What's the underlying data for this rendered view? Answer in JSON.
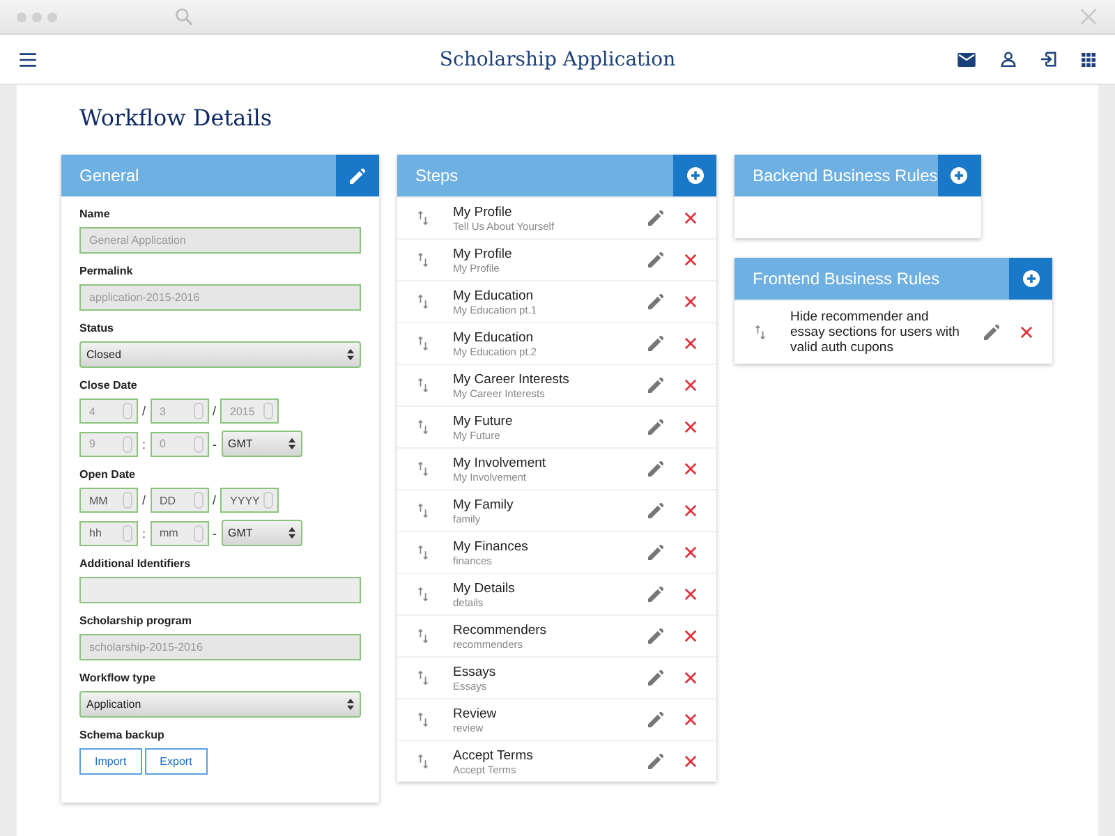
{
  "app_bar": {
    "title": "Scholarship Application"
  },
  "heading": "Workflow Details",
  "general": {
    "title": "General",
    "fields": [
      {
        "kind": "text",
        "label": "Name",
        "value": "General Application",
        "disabled": true
      },
      {
        "kind": "text",
        "label": "Permalink",
        "value": "application-2015-2016",
        "disabled": true
      },
      {
        "kind": "select",
        "label": "Status",
        "value": "Closed"
      },
      {
        "kind": "datetime",
        "label": "Close Date",
        "date": [
          {
            "value": "4"
          },
          {
            "separator": "/",
            "value": "3"
          },
          {
            "separator": "/",
            "value": "2015"
          }
        ],
        "time": [
          {
            "value": "9"
          },
          {
            "separator": ":",
            "value": "0"
          }
        ],
        "zone_separator": "-",
        "timezone": "GMT"
      },
      {
        "kind": "datetime",
        "label": "Open Date",
        "date": [
          {
            "placeholder": "MM"
          },
          {
            "separator": "/",
            "placeholder": "DD"
          },
          {
            "separator": "/",
            "placeholder": "YYYY"
          }
        ],
        "time": [
          {
            "placeholder": "hh"
          },
          {
            "separator": ":",
            "placeholder": "mm"
          }
        ],
        "zone_separator": "-",
        "timezone": "GMT"
      },
      {
        "kind": "text",
        "label": "Additional Identifiers"
      },
      {
        "kind": "text",
        "label": "Scholarship program",
        "value": "scholarship-2015-2016",
        "disabled": true
      },
      {
        "kind": "select",
        "label": "Workflow type",
        "value": "Application"
      },
      {
        "kind": "buttons",
        "label": "Schema backup",
        "buttons": [
          "Import",
          "Export"
        ]
      }
    ]
  },
  "steps": {
    "title": "Steps",
    "items": [
      {
        "title": "My Profile",
        "subtitle": "Tell Us About Yourself"
      },
      {
        "title": "My Profile",
        "subtitle": "My Profile"
      },
      {
        "title": "My Education",
        "subtitle": "My Education pt.1"
      },
      {
        "title": "My Education",
        "subtitle": "My Education pt.2"
      },
      {
        "title": "My Career Interests",
        "subtitle": "My Career Interests"
      },
      {
        "title": "My Future",
        "subtitle": "My Future"
      },
      {
        "title": "My Involvement",
        "subtitle": "My Involvement"
      },
      {
        "title": "My Family",
        "subtitle": "family"
      },
      {
        "title": "My Finances",
        "subtitle": "finances"
      },
      {
        "title": "My Details",
        "subtitle": "details"
      },
      {
        "title": "Recommenders",
        "subtitle": "recommenders"
      },
      {
        "title": "Essays",
        "subtitle": "Essays"
      },
      {
        "title": "Review",
        "subtitle": "review"
      },
      {
        "title": "Accept Terms",
        "subtitle": "Accept Terms"
      }
    ]
  },
  "backend_rules": {
    "title": "Backend Business Rules"
  },
  "frontend_rules": {
    "title": "Frontend Business Rules",
    "items": [
      {
        "text": "Hide recommender and essay sections for users with valid auth cupons"
      }
    ]
  }
}
